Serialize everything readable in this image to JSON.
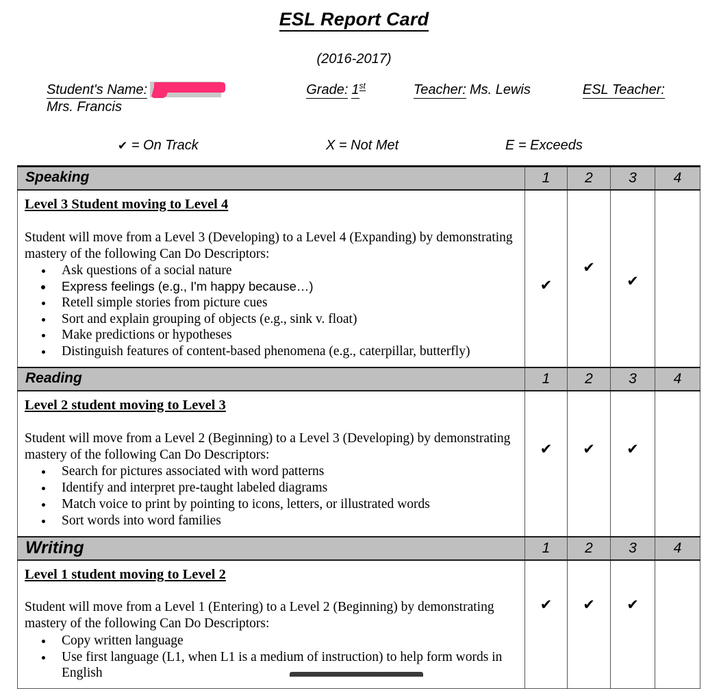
{
  "document": {
    "title": "ESL Report Card",
    "school_year": "(2016-2017)"
  },
  "student_info": {
    "name_label": "Student's Name:",
    "name_value": "",
    "name_redacted": true,
    "grade_label": "Grade:",
    "grade_value": "1",
    "grade_suffix": "st",
    "teacher_label": "Teacher:",
    "teacher_value": "Ms. Lewis",
    "esl_teacher_label": "ESL Teacher:",
    "esl_teacher_value": "Mrs. Francis"
  },
  "legend": {
    "on_track_symbol": "✔",
    "on_track_text": "= On Track",
    "not_met": "X = Not Met",
    "exceeds": "E = Exceeds"
  },
  "table": {
    "score_columns": [
      "1",
      "2",
      "3",
      "4"
    ],
    "check_mark": "✔",
    "sections": [
      {
        "name": "Speaking",
        "level_heading": "Level 3 Student moving to Level 4",
        "intro": "Student will move from a Level 3 (Developing) to a Level 4 (Expanding) by demonstrating mastery of the following Can Do Descriptors:",
        "descriptors": [
          "Ask questions of a social nature",
          "Express feelings (e.g., I'm happy because…)",
          "Retell simple stories from picture cues",
          "Sort and explain grouping of objects (e.g., sink v. float)",
          "Make predictions or hypotheses",
          "Distinguish features of content-based phenomena (e.g., caterpillar, butterfly)"
        ],
        "marks": [
          "✔",
          "✔",
          "✔",
          ""
        ]
      },
      {
        "name": "Reading",
        "level_heading": "Level 2 student moving to Level 3",
        "intro": "Student will move from a Level 2 (Beginning) to a Level 3 (Developing) by demonstrating mastery of the following Can Do Descriptors:",
        "descriptors": [
          "Search for pictures associated with word patterns",
          "Identify and interpret pre-taught labeled diagrams",
          "Match voice to print by pointing to icons, letters, or illustrated words",
          "Sort words into word families"
        ],
        "marks": [
          "✔",
          "✔",
          "✔",
          ""
        ]
      },
      {
        "name": "Writing",
        "level_heading": "Level 1 student moving to Level 2",
        "intro": "Student will move from a Level 1 (Entering) to a Level 2 (Beginning) by demonstrating mastery of the following Can Do Descriptors:",
        "descriptors": [
          "Copy written language",
          "Use first language (L1, when L1 is a medium of instruction) to help form words in English"
        ],
        "marks": [
          "✔",
          "✔",
          "✔",
          ""
        ]
      }
    ]
  },
  "colors": {
    "header_gray": "#BFBFBF",
    "redaction_pink": "#FF2D72",
    "selection_gray": "#C8C8C8",
    "text": "#000000"
  }
}
